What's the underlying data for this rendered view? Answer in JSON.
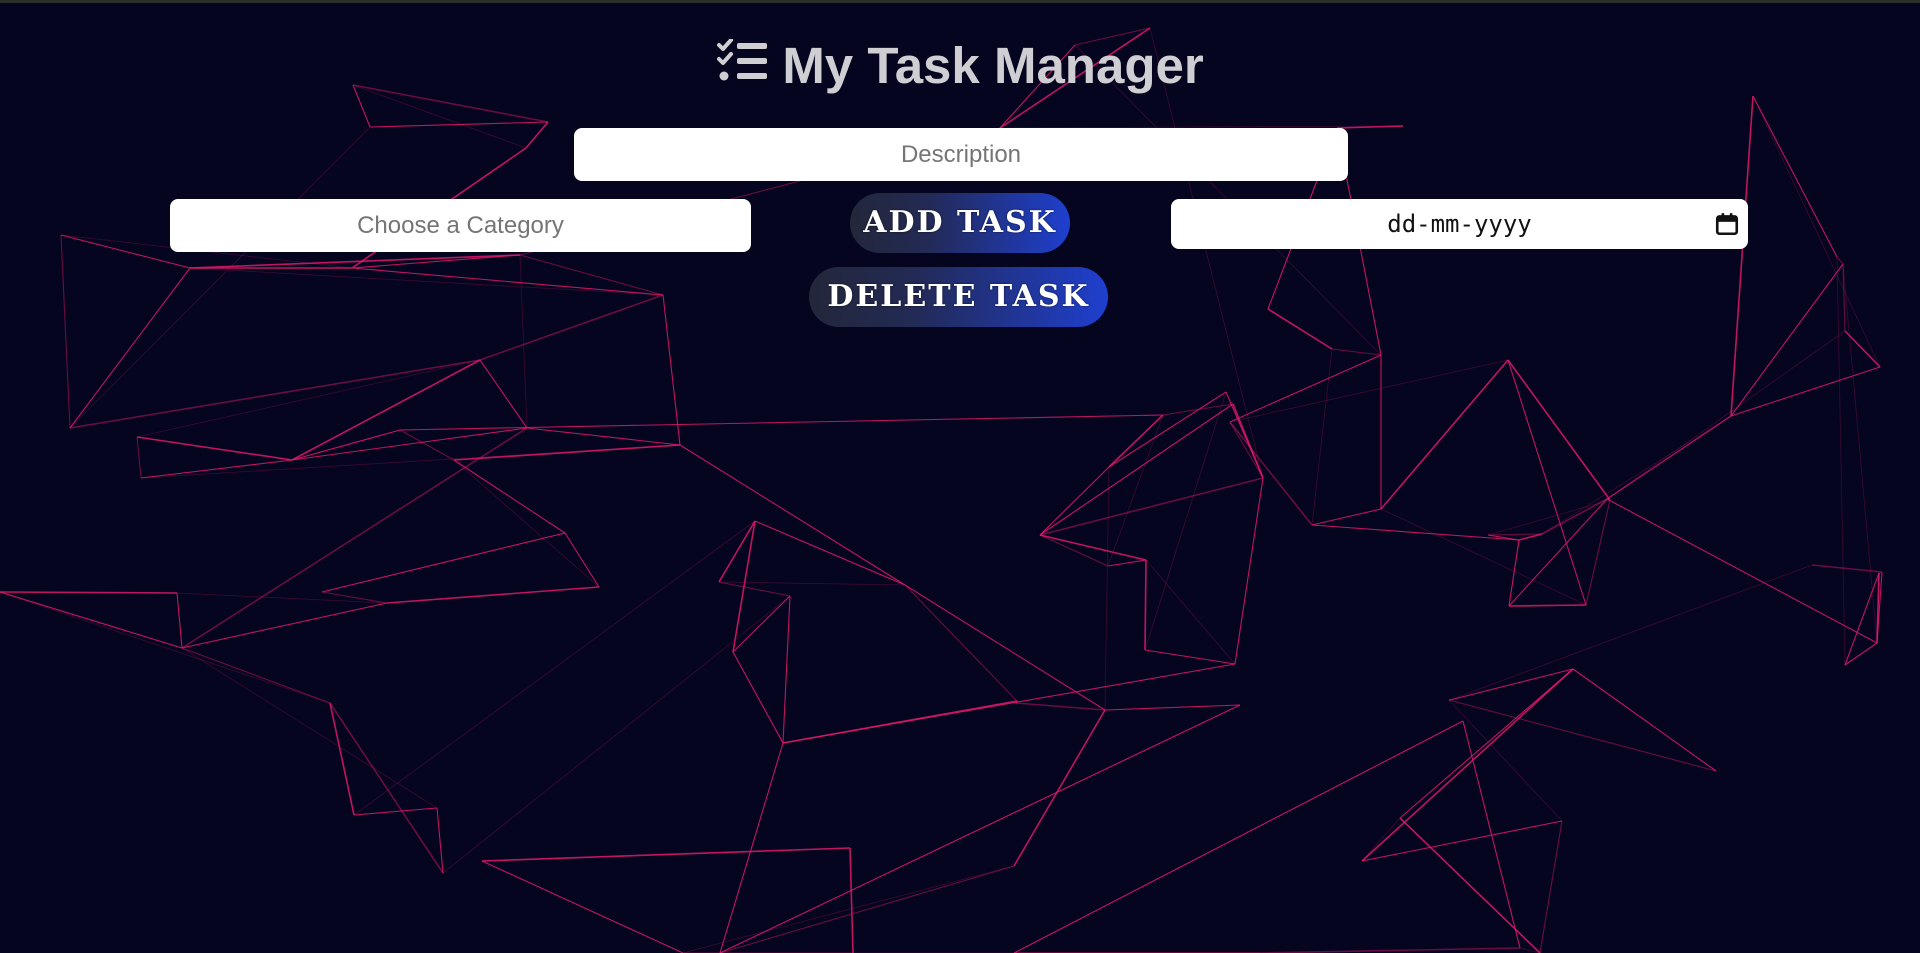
{
  "header": {
    "title": "My Task Manager",
    "icon": "checklist-icon"
  },
  "form": {
    "description_placeholder": "Description",
    "category_placeholder": "Choose a Category",
    "date_placeholder": "dd-mm-yyyy",
    "calendar_icon": "calendar-icon"
  },
  "buttons": {
    "add_label": "ADD TASK",
    "delete_label": "DELETE TASK"
  },
  "colors": {
    "background": "#060520",
    "network_lines": "#e0196b",
    "button_gradient_end": "#1f3fcf",
    "title": "#cfcfd3"
  }
}
